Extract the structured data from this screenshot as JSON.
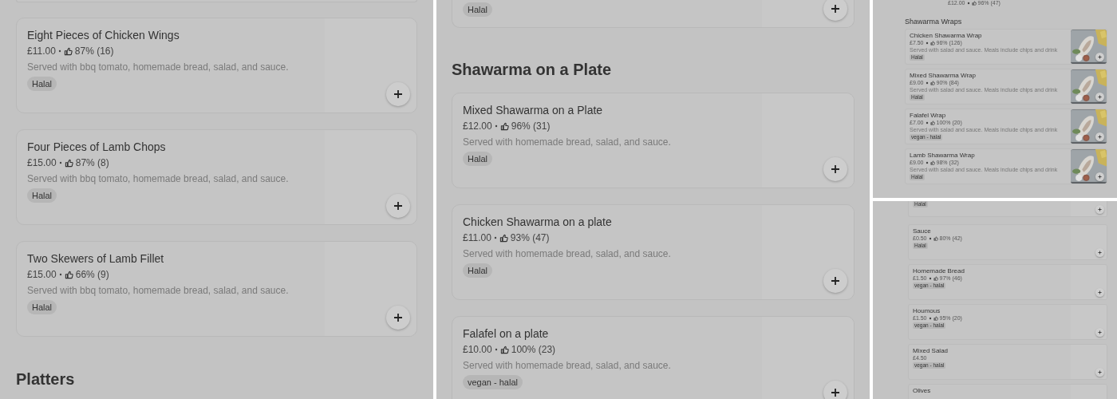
{
  "panels": [
    {
      "blocks": [
        {
          "kind": "cut_top"
        },
        {
          "kind": "item",
          "name": "Eight Pieces of Chicken Wings",
          "price": "£11.00",
          "rating": "87% (16)",
          "description": "Served with bbq tomato, homemade bread, salad, and sauce.",
          "tag": "Halal",
          "image": false
        },
        {
          "kind": "item",
          "name": "Four Pieces of Lamb Chops",
          "price": "£15.00",
          "rating": "87% (8)",
          "description": "Served with bbq tomato, homemade bread, salad, and sauce.",
          "tag": "Halal",
          "image": false
        },
        {
          "kind": "item",
          "name": "Two Skewers of Lamb Fillet",
          "price": "£15.00",
          "rating": "66% (9)",
          "description": "Served with bbq tomato, homemade bread, salad, and sauce.",
          "tag": "Halal",
          "image": false
        },
        {
          "kind": "heading",
          "title": "Platters"
        }
      ]
    },
    {
      "blocks": [
        {
          "kind": "cut_tag",
          "tag": "Halal"
        },
        {
          "kind": "heading",
          "title": "Shawarma on a Plate"
        },
        {
          "kind": "item",
          "name": "Mixed Shawarma on a Plate",
          "price": "£12.00",
          "rating": "96% (31)",
          "description": "Served with homemade bread, salad, and sauce.",
          "tag": "Halal",
          "image": false
        },
        {
          "kind": "item",
          "name": "Chicken Shawarma on a plate",
          "price": "£11.00",
          "rating": "93% (47)",
          "description": "Served with homemade bread, salad, and sauce.",
          "tag": "Halal",
          "image": false
        },
        {
          "kind": "item",
          "name": "Falafel on a plate",
          "price": "£10.00",
          "rating": "100% (23)",
          "description": "Served with homemade bread, salad, and sauce.",
          "tag": "vegan - halal",
          "image": false
        }
      ]
    },
    {
      "blocks": [
        {
          "kind": "cut_price",
          "price": "£12.00",
          "rating": "96% (47)"
        },
        {
          "kind": "heading",
          "title": "Shawarma Wraps"
        },
        {
          "kind": "item",
          "name": "Chicken Shawarma Wrap",
          "price": "£7.50",
          "rating": "96% (126)",
          "description": "Served with salad and sauce. Meals include chips and drink",
          "tag": "Halal",
          "image": true
        },
        {
          "kind": "item",
          "name": "Mixed Shawarma Wrap",
          "price": "£9.00",
          "rating": "90% (84)",
          "description": "Served with salad and sauce. Meals include chips and drink",
          "tag": "Halal",
          "image": true
        },
        {
          "kind": "item",
          "name": "Falafel Wrap",
          "price": "£7.00",
          "rating": "100% (20)",
          "description": "Served with salad and sauce. Meals include chips and drink",
          "tag": "vegan - halal",
          "image": true
        },
        {
          "kind": "item",
          "name": "Lamb Shawarma Wrap",
          "price": "£9.00",
          "rating": "98% (32)",
          "description": "Served with salad and sauce. Meals include chips and drink",
          "tag": "Halal",
          "image": true
        }
      ]
    },
    {
      "blocks": [
        {
          "kind": "cut_tag",
          "tag": "Halal"
        },
        {
          "kind": "item",
          "name": "Sauce",
          "price": "£0.50",
          "rating": "80% (42)",
          "tag": "Halal",
          "image": false
        },
        {
          "kind": "item",
          "name": "Homemade Bread",
          "price": "£1.50",
          "rating": "97% (46)",
          "tag": "vegan - halal",
          "image": false
        },
        {
          "kind": "item",
          "name": "Houmous",
          "price": "£1.50",
          "rating": "95% (20)",
          "tag": "vegan - halal",
          "image": false
        },
        {
          "kind": "item",
          "name": "Mixed Salad",
          "price": "£4.50",
          "tag": "vegan - halal",
          "image": false
        },
        {
          "kind": "item",
          "name": "Olives",
          "image": false
        }
      ]
    }
  ]
}
